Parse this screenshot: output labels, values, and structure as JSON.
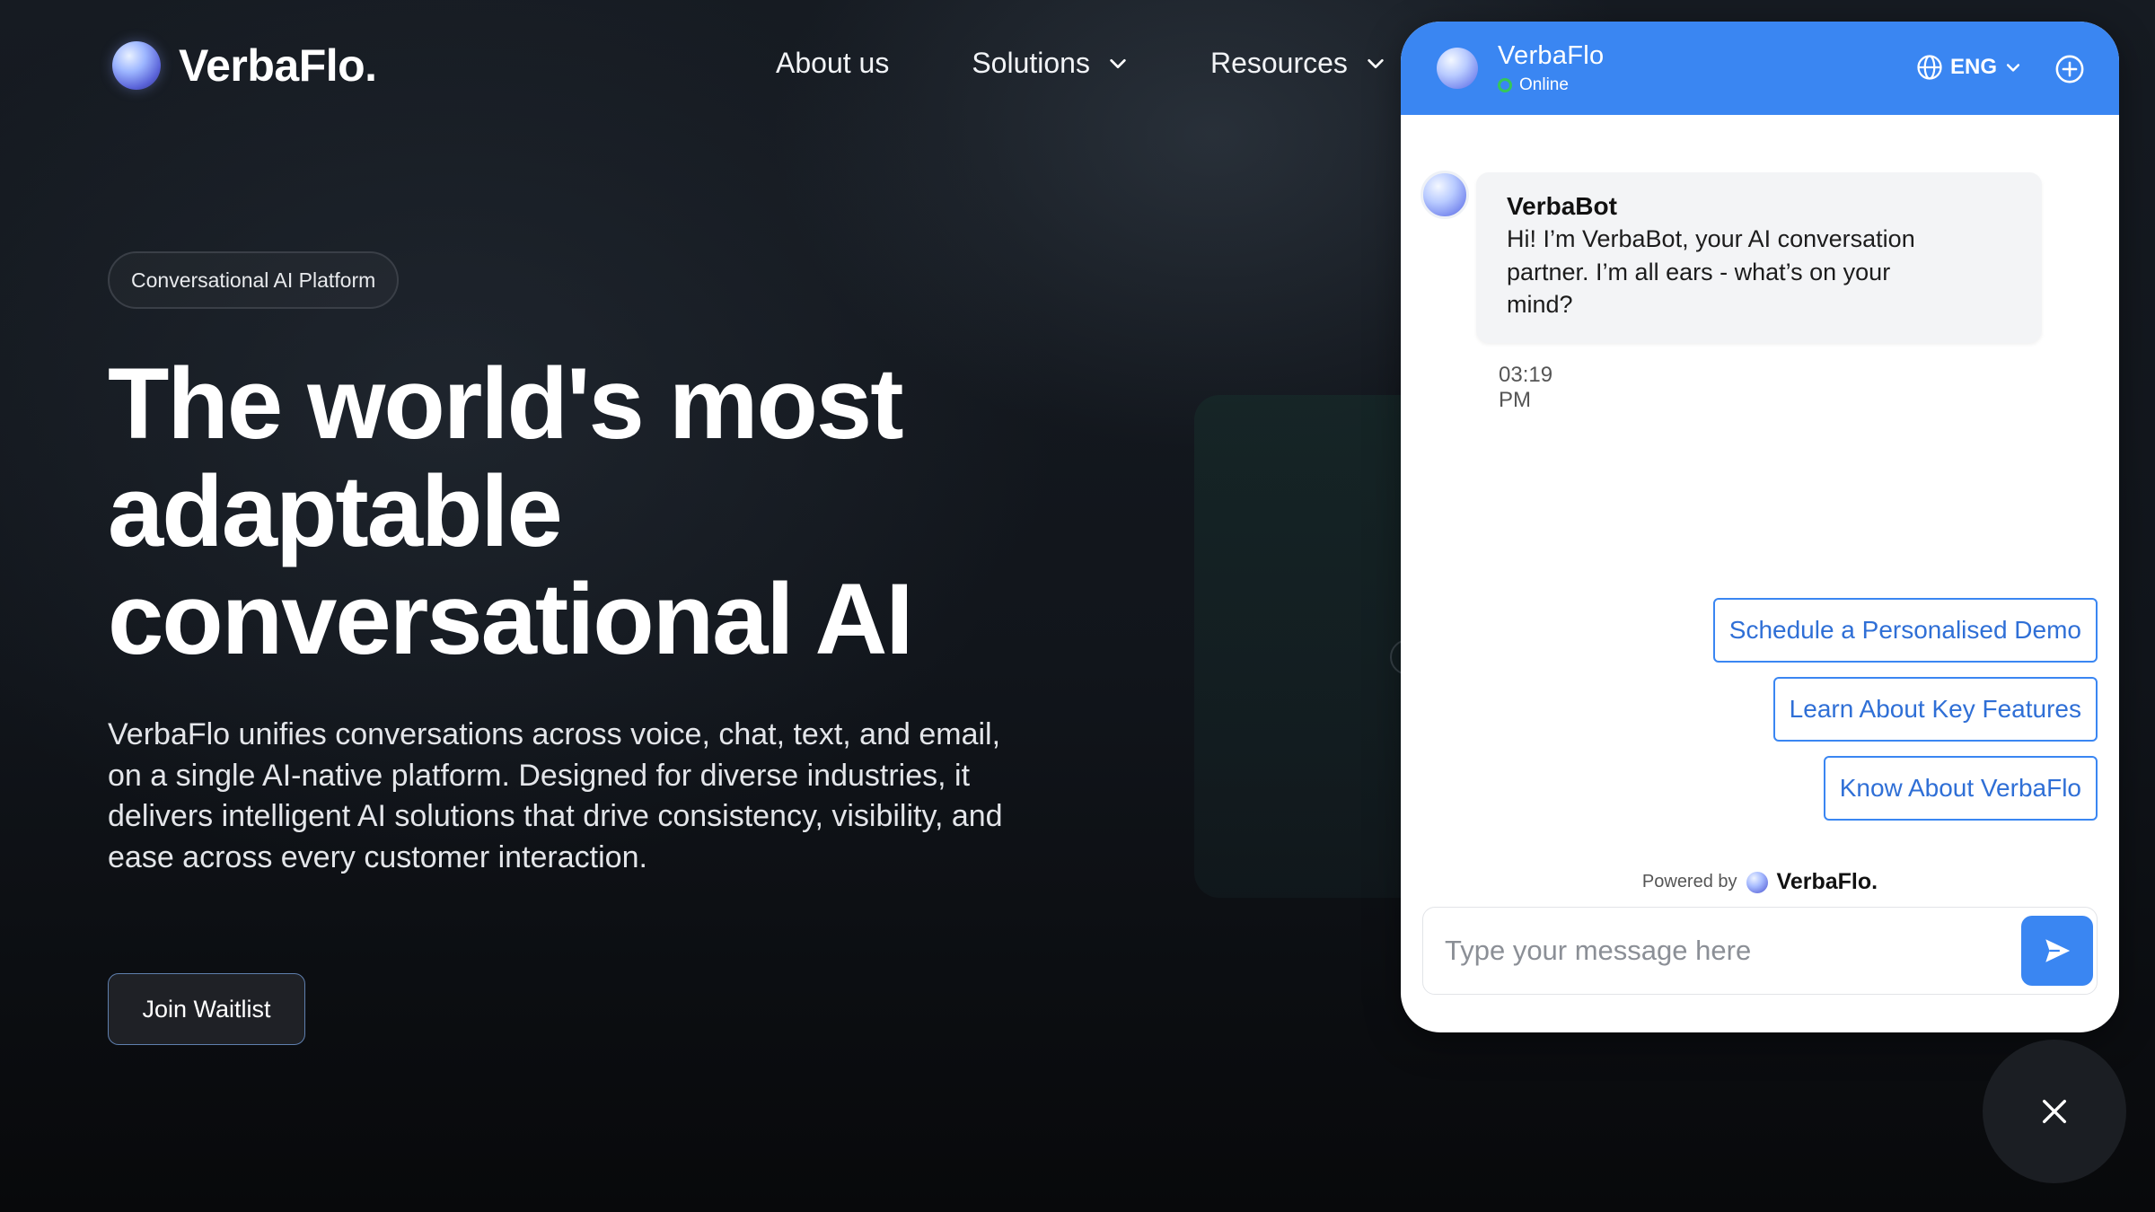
{
  "brand": {
    "name": "VerbaFlo."
  },
  "nav": {
    "items": [
      {
        "label": "About us",
        "has_dropdown": false
      },
      {
        "label": "Solutions",
        "has_dropdown": true
      },
      {
        "label": "Resources",
        "has_dropdown": true
      }
    ]
  },
  "hero": {
    "pill": "Conversational AI Platform",
    "headline": [
      "The world's most",
      "adaptable",
      "conversational AI"
    ],
    "description": "VerbaFlo unifies conversations across voice, chat, text, and email, on a single AI-native platform. Designed for diverse industries, it delivers intelligent AI solutions that drive consistency, visibility, and ease across every customer interaction.",
    "cta": "Join Waitlist"
  },
  "chat": {
    "title": "VerbaFlo",
    "status": "Online",
    "language": "ENG",
    "message": {
      "sender": "VerbaBot",
      "text": "Hi! I’m VerbaBot, your AI conversation partner. I’m all ears - what’s on your mind?",
      "time": "03:19 PM"
    },
    "quick_replies": [
      "Schedule a Personalised Demo",
      "Learn About Key Features",
      "Know About VerbaFlo"
    ],
    "powered_by_label": "Powered by",
    "powered_by_brand": "VerbaFlo.",
    "input_placeholder": "Type your message here"
  },
  "icons": {
    "nav_dropdown": "chevron-down-icon",
    "language": "globe-icon",
    "new_chat": "plus-circle-icon",
    "send": "send-icon",
    "close": "close-icon"
  },
  "colors": {
    "chat_accent": "#3a86f2",
    "page_background": "#0d1117",
    "online": "#35c759"
  }
}
